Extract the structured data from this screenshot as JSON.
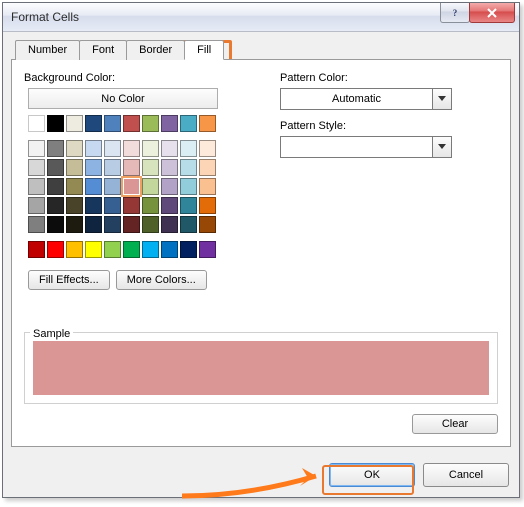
{
  "window": {
    "title": "Format Cells"
  },
  "tabs": {
    "number": "Number",
    "font": "Font",
    "border": "Border",
    "fill": "Fill",
    "active": "fill"
  },
  "labels": {
    "bgcolor": "Background Color:",
    "nocolor": "No Color",
    "fillEffects": "Fill Effects...",
    "moreColors": "More Colors...",
    "patternColor": "Pattern Color:",
    "patternStyle": "Pattern Style:",
    "automatic": "Automatic",
    "sample": "Sample",
    "clear": "Clear",
    "ok": "OK",
    "cancel": "Cancel"
  },
  "palette": {
    "row1": [
      "#FFFFFF",
      "#000000",
      "#EEECE1",
      "#1F497D",
      "#4F81BD",
      "#C0504D",
      "#9BBB59",
      "#8064A2",
      "#4BACC6",
      "#F79646"
    ],
    "themeGrid": [
      [
        "#F2F2F2",
        "#7F7F7F",
        "#DDD9C3",
        "#C6D9F0",
        "#DBE5F1",
        "#F2DCDB",
        "#EBF1DD",
        "#E5E0EC",
        "#DBEEF3",
        "#FDEADA"
      ],
      [
        "#D8D8D8",
        "#595959",
        "#C4BD97",
        "#8DB3E2",
        "#B8CCE4",
        "#E5B9B7",
        "#D7E3BC",
        "#CCC1D9",
        "#B7DDE8",
        "#FBD5B5"
      ],
      [
        "#BFBFBF",
        "#3F3F3F",
        "#938953",
        "#548DD4",
        "#95B3D7",
        "#D99694",
        "#C3D69B",
        "#B2A2C7",
        "#92CDDC",
        "#FAC08F"
      ],
      [
        "#A5A5A5",
        "#262626",
        "#494429",
        "#17365D",
        "#366092",
        "#953734",
        "#76923C",
        "#5F497A",
        "#31859B",
        "#E36C09"
      ],
      [
        "#7F7F7F",
        "#0C0C0C",
        "#1D1B10",
        "#0F243E",
        "#244061",
        "#632423",
        "#4F6128",
        "#3F3151",
        "#205867",
        "#974806"
      ]
    ],
    "standard": [
      "#C00000",
      "#FF0000",
      "#FFC000",
      "#FFFF00",
      "#92D050",
      "#00B050",
      "#00B0F0",
      "#0070C0",
      "#002060",
      "#7030A0"
    ],
    "selected": {
      "grid": "themeGrid",
      "row": 2,
      "col": 5
    }
  },
  "sample": {
    "color": "#D99694"
  }
}
